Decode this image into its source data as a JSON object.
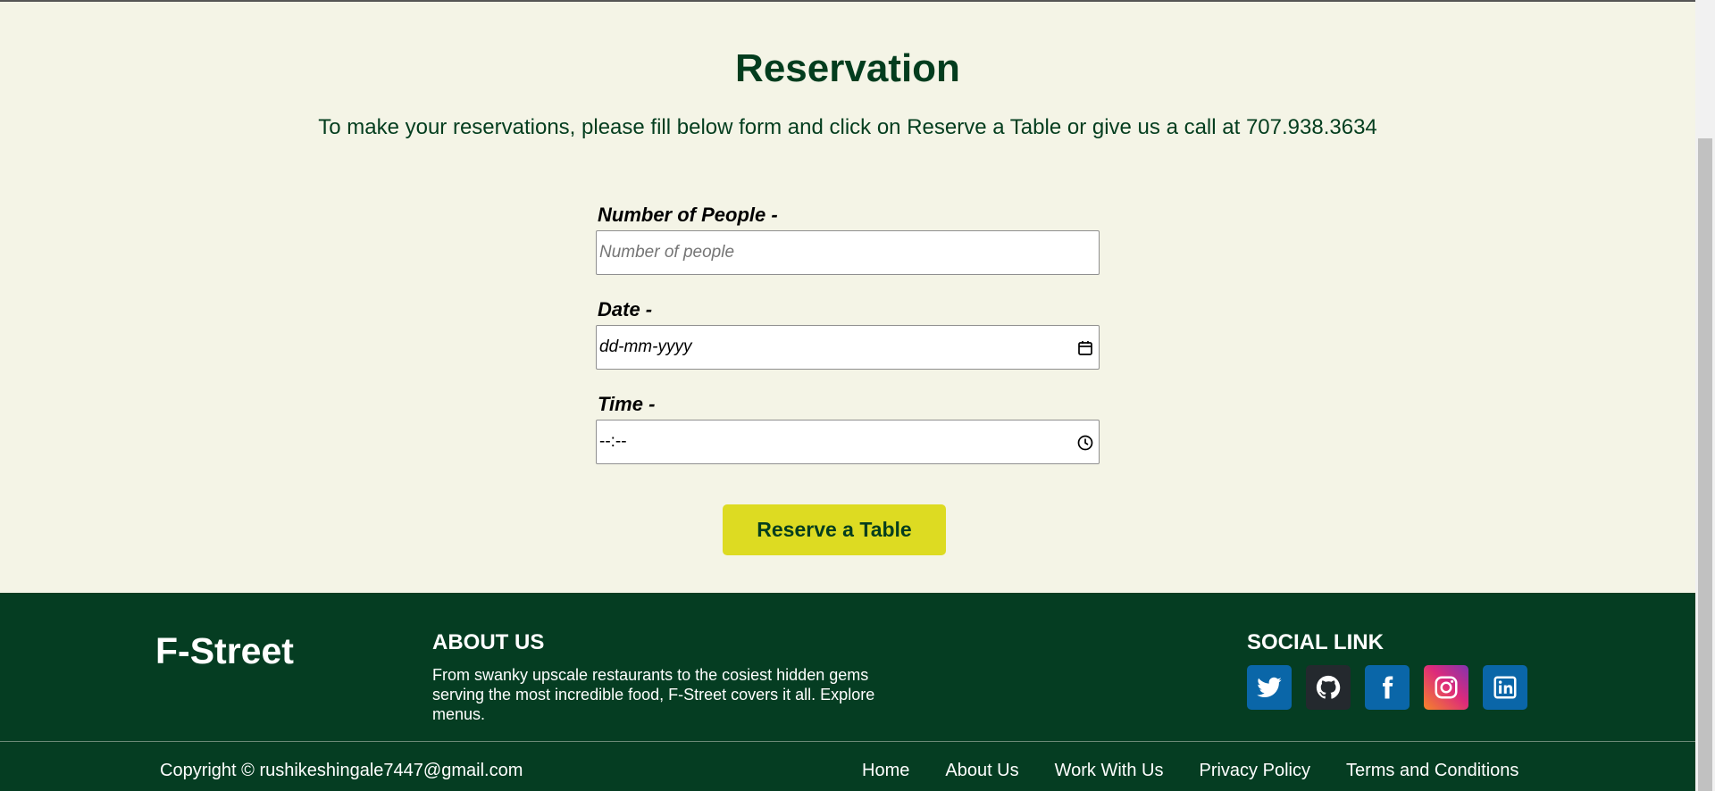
{
  "reservation": {
    "title": "Reservation",
    "subtitle": "To make your reservations, please fill below form and click on Reserve a Table or give us a call at 707.938.3634"
  },
  "form": {
    "people_label": "Number of People -",
    "people_placeholder": "Number of people",
    "date_label": "Date -",
    "date_value": "dd-mm-yyyy",
    "time_label": "Time -",
    "time_value": "--:--",
    "submit_label": "Reserve a Table"
  },
  "footer": {
    "brand": "F-Street",
    "about_title": "ABOUT US",
    "about_text": "From swanky upscale restaurants to the cosiest hidden gems serving the most incredible food, F-Street covers it all. Explore menus.",
    "social_title": "SOCIAL LINK",
    "socials": [
      {
        "icon": "twitter-icon",
        "color": "#0a66a8"
      },
      {
        "icon": "github-icon",
        "color": "#24292e"
      },
      {
        "icon": "facebook-icon",
        "color": "#0a66a8"
      },
      {
        "icon": "instagram-icon",
        "color": "#d6249f"
      },
      {
        "icon": "linkedin-icon",
        "color": "#0a66a8"
      }
    ],
    "copyright": "Copyright © rushikeshingale7447@gmail.com",
    "nav": [
      "Home",
      "About Us",
      "Work With Us",
      "Privacy Policy",
      "Terms and Conditions"
    ]
  },
  "colors": {
    "background": "#f4f4e6",
    "primary_green": "#033d1e",
    "footer_green": "#053d22",
    "button_yellow": "#dddb22"
  }
}
